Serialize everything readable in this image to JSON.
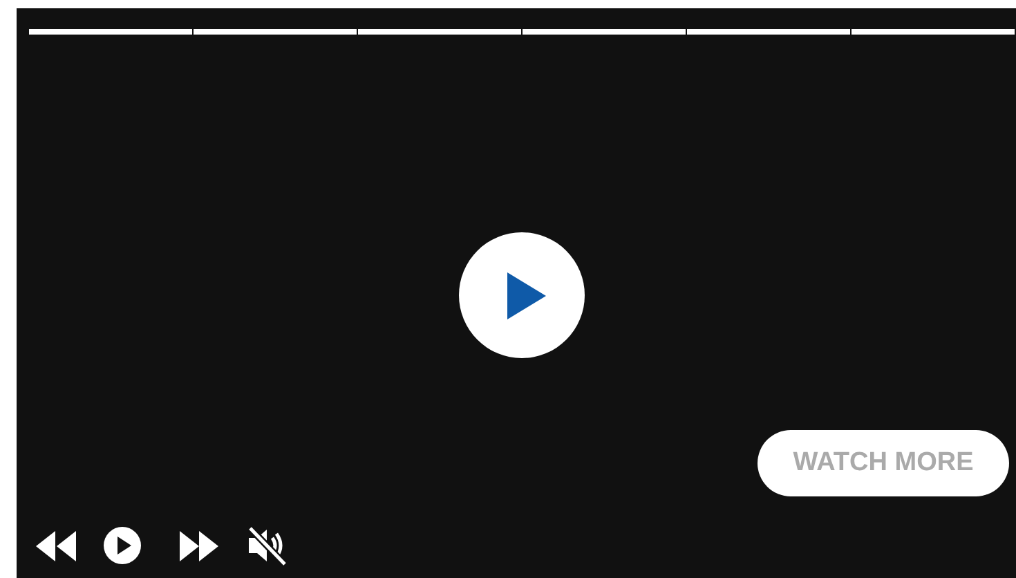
{
  "segments": [
    {
      "level": 1
    },
    {
      "level": 1
    },
    {
      "level": 1
    },
    {
      "level": 1
    },
    {
      "level": 1
    },
    {
      "level": 1
    }
  ],
  "playing": false,
  "muted": true,
  "watch_more": {
    "label": "WATCH MORE"
  }
}
